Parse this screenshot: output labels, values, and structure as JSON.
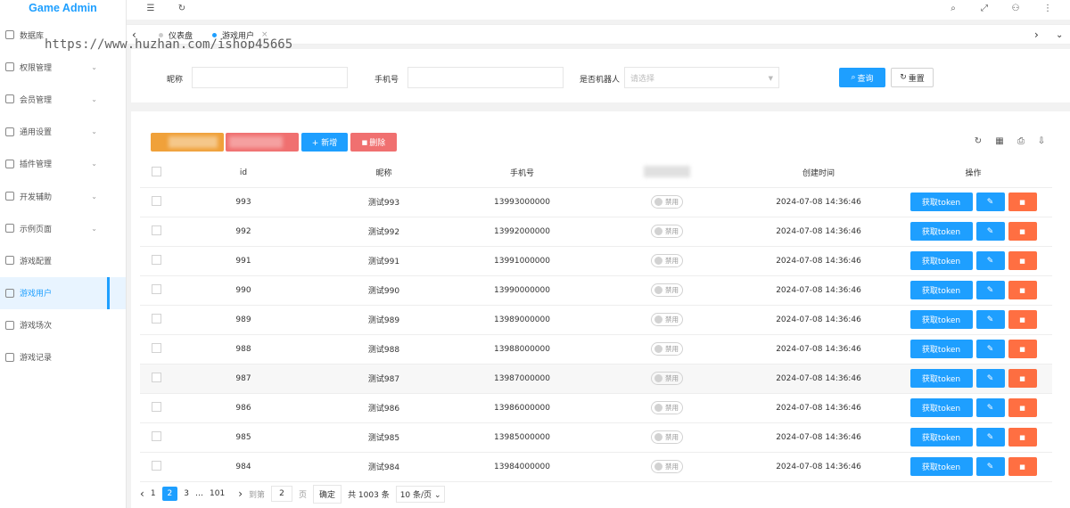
{
  "app": {
    "title": "Game Admin"
  },
  "sidebar": {
    "items": [
      {
        "label": "数据库",
        "icon": "database-icon",
        "arrow": ""
      },
      {
        "label": "权限管理",
        "icon": "shield-icon",
        "arrow": "⌄"
      },
      {
        "label": "会员管理",
        "icon": "user-icon",
        "arrow": "⌄"
      },
      {
        "label": "通用设置",
        "icon": "gear-icon",
        "arrow": "⌄"
      },
      {
        "label": "插件管理",
        "icon": "plugin-icon",
        "arrow": "⌄"
      },
      {
        "label": "开发辅助",
        "icon": "code-icon",
        "arrow": "⌄"
      },
      {
        "label": "示例页面",
        "icon": "image-icon",
        "arrow": "⌄"
      },
      {
        "label": "游戏配置",
        "icon": "settings-icon",
        "arrow": ""
      },
      {
        "label": "游戏用户",
        "icon": "user-icon",
        "arrow": ""
      },
      {
        "label": "游戏场次",
        "icon": "clock-icon",
        "arrow": ""
      },
      {
        "label": "游戏记录",
        "icon": "chart-icon",
        "arrow": ""
      }
    ],
    "active_index": 8
  },
  "topbar": {
    "icons": {
      "menu": "☰",
      "refresh": "↻",
      "search": "⌕",
      "fullscreen": "⤢",
      "user": "⚇",
      "more": "⋮"
    }
  },
  "tabs": {
    "items": [
      {
        "label": "仪表盘"
      },
      {
        "label": "游戏用户"
      }
    ],
    "nav": {
      "prev": "‹",
      "next": "›",
      "dropdown": "⌄"
    },
    "close": "×"
  },
  "watermark": "https://www.huzhan.com/ishop45665",
  "search": {
    "nickname_label": "昵称",
    "phone_label": "手机号",
    "robot_label": "是否机器人",
    "robot_placeholder": "请选择",
    "query_label": "查询",
    "reset_label": "重置",
    "query_icon": "⌕",
    "reset_icon": "↻"
  },
  "toolbar": {
    "add_label": "+ 新增",
    "delete_label": "删除",
    "icons": {
      "refresh": "↻",
      "columns": "▦",
      "print": "⎙",
      "export": "⇩"
    }
  },
  "table": {
    "headers": {
      "id": "id",
      "nickname": "昵称",
      "phone": "手机号",
      "created": "创建时间",
      "ops": "操作"
    },
    "switch_label": "禁用",
    "token_label": "获取token",
    "edit_icon": "✎",
    "delete_icon": "🗑",
    "rows": [
      {
        "id": "993",
        "nickname": "测试993",
        "phone": "13993000000",
        "created": "2024-07-08 14:36:46"
      },
      {
        "id": "992",
        "nickname": "测试992",
        "phone": "13992000000",
        "created": "2024-07-08 14:36:46"
      },
      {
        "id": "991",
        "nickname": "测试991",
        "phone": "13991000000",
        "created": "2024-07-08 14:36:46"
      },
      {
        "id": "990",
        "nickname": "测试990",
        "phone": "13990000000",
        "created": "2024-07-08 14:36:46"
      },
      {
        "id": "989",
        "nickname": "测试989",
        "phone": "13989000000",
        "created": "2024-07-08 14:36:46"
      },
      {
        "id": "988",
        "nickname": "测试988",
        "phone": "13988000000",
        "created": "2024-07-08 14:36:46"
      },
      {
        "id": "987",
        "nickname": "测试987",
        "phone": "13987000000",
        "created": "2024-07-08 14:36:46"
      },
      {
        "id": "986",
        "nickname": "测试986",
        "phone": "13986000000",
        "created": "2024-07-08 14:36:46"
      },
      {
        "id": "985",
        "nickname": "测试985",
        "phone": "13985000000",
        "created": "2024-07-08 14:36:46"
      },
      {
        "id": "984",
        "nickname": "测试984",
        "phone": "13984000000",
        "created": "2024-07-08 14:36:46"
      }
    ]
  },
  "pagination": {
    "prev": "‹",
    "next": "›",
    "page1": "1",
    "current": "2",
    "page3": "3",
    "ellipsis": "…",
    "last": "101",
    "goto_label": "到第",
    "goto_value": "2",
    "page_unit": "页",
    "confirm_label": "确定",
    "total_label": "共 1003 条",
    "per_page": "10 条/页",
    "per_page_caret": "⌄"
  },
  "colors": {
    "primary": "#1e9fff",
    "danger": "#ff5722",
    "warm": "#f0a13a"
  }
}
